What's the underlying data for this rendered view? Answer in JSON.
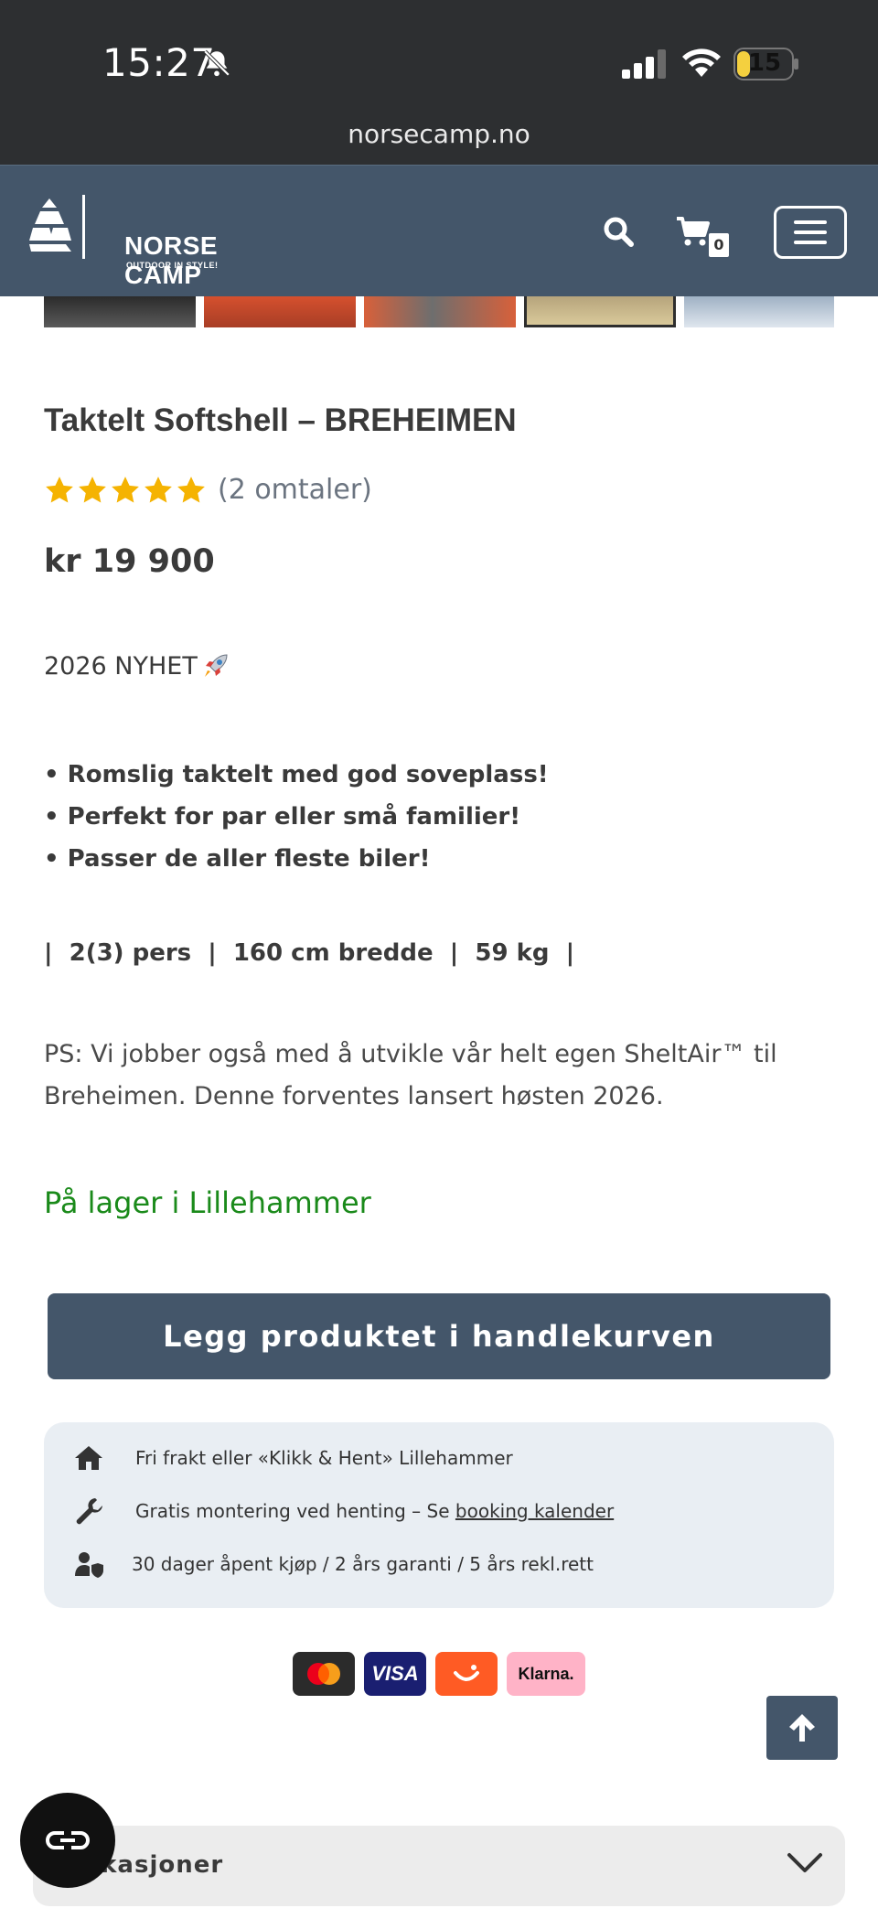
{
  "status_bar": {
    "time": "15:27",
    "battery": "15",
    "url": "norsecamp.no"
  },
  "header": {
    "logo_name": "NORSE CAMP",
    "logo_tagline": "OUTDOOR IN STYLE!",
    "cart_count": "0"
  },
  "product": {
    "title": "Taktelt Softshell – BREHEIMEN",
    "rating_stars": 5,
    "review_count": "(2 omtaler)",
    "price": "kr 19 900",
    "news": "2026 NYHET",
    "bullets": [
      "• Romslig taktelt med god soveplass!",
      "• Perfekt for par eller små familier!",
      "• Passer de aller fleste biler!"
    ],
    "specs": "|  2(3) pers  |  160 cm bredde  |  59 kg  |",
    "ps": "PS: Vi jobber også med å utvikle vår helt egen SheltAir™ til Breheimen. Denne forventes lansert høsten 2026.",
    "stock": "På lager i Lillehammer",
    "add_to_cart": "Legg produktet i handlekurven"
  },
  "info": {
    "shipping": "Fri frakt eller «Klikk & Hent» Lillehammer",
    "mounting_prefix": "Gratis montering ved henting – Se ",
    "mounting_link": "booking kalender",
    "guarantee": "30 dager åpent kjøp / 2 års garanti / 5 års rekl.rett"
  },
  "payments": {
    "visa": "VISA",
    "klarna": "Klarna."
  },
  "accordion": {
    "label": "ifikasjoner"
  },
  "colors": {
    "header": "#44566a",
    "stock": "#1a8a1a",
    "star": "#f5b301"
  },
  "icons": [
    "bell-slash-icon",
    "signal-icon",
    "wifi-icon",
    "battery-icon",
    "search-icon",
    "cart-icon",
    "menu-icon",
    "star-icon",
    "rocket-icon",
    "home-icon",
    "wrench-icon",
    "user-shield-icon",
    "arrow-up-icon",
    "chevron-down-icon",
    "cookie-icon"
  ]
}
